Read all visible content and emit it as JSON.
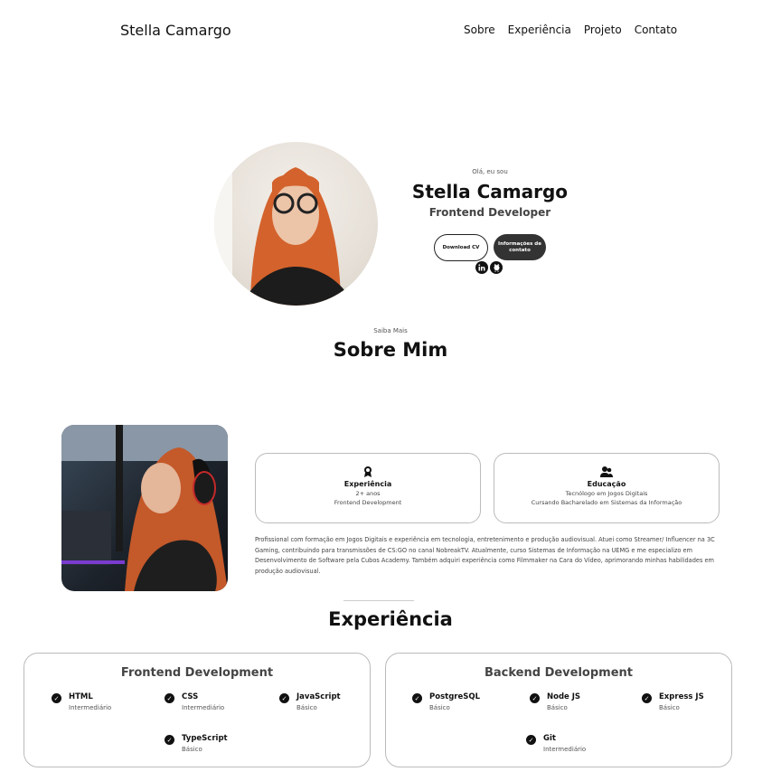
{
  "header": {
    "logo": "Stella Camargo",
    "nav": [
      "Sobre",
      "Experiência",
      "Projeto",
      "Contato"
    ]
  },
  "hero": {
    "greeting": "Olá, eu sou",
    "name": "Stella Camargo",
    "role": "Frontend Developer",
    "download_cv": "Download CV",
    "contact_info": "Informações de contato",
    "social_icons": [
      "linkedin-icon",
      "github-icon"
    ]
  },
  "about": {
    "subtitle": "Saiba Mais",
    "title": "Sobre Mim",
    "cards": [
      {
        "icon": "award-icon",
        "title": "Experiência",
        "lines": [
          "2+ anos",
          "Frontend Development"
        ]
      },
      {
        "icon": "users-icon",
        "title": "Educação",
        "lines": [
          "Tecnólogo em Jogos Digitais",
          "Cursando Bacharelado em Sistemas da Informação"
        ]
      }
    ],
    "text": "Profissional com formação em Jogos Digitais e experiência em tecnologia, entretenimento e produção audiovisual. Atuei como Streamer/ Influencer na 3C Gaming, contribuindo para transmissões de CS:GO no canal NobreakTV. Atualmente, curso Sistemas de Informação na UEMG e me especializo em Desenvolvimento de Software pela Cubos Academy. Também adquiri experiência como Filmmaker na Cara do Vídeo, aprimorando minhas habilidades em produção audiovisual."
  },
  "experience": {
    "title": "Experiência",
    "frontend": {
      "title": "Frontend Development",
      "skills": [
        {
          "name": "HTML",
          "level": "Intermediário"
        },
        {
          "name": "CSS",
          "level": "Intermediário"
        },
        {
          "name": "JavaScript",
          "level": "Básico"
        },
        {
          "name": "TypeScript",
          "level": "Básico"
        }
      ]
    },
    "backend": {
      "title": "Backend Development",
      "skills": [
        {
          "name": "PostgreSQL",
          "level": "Básico"
        },
        {
          "name": "Node JS",
          "level": "Básico"
        },
        {
          "name": "Express JS",
          "level": "Básico"
        },
        {
          "name": "Git",
          "level": "Intermediário"
        }
      ]
    }
  }
}
